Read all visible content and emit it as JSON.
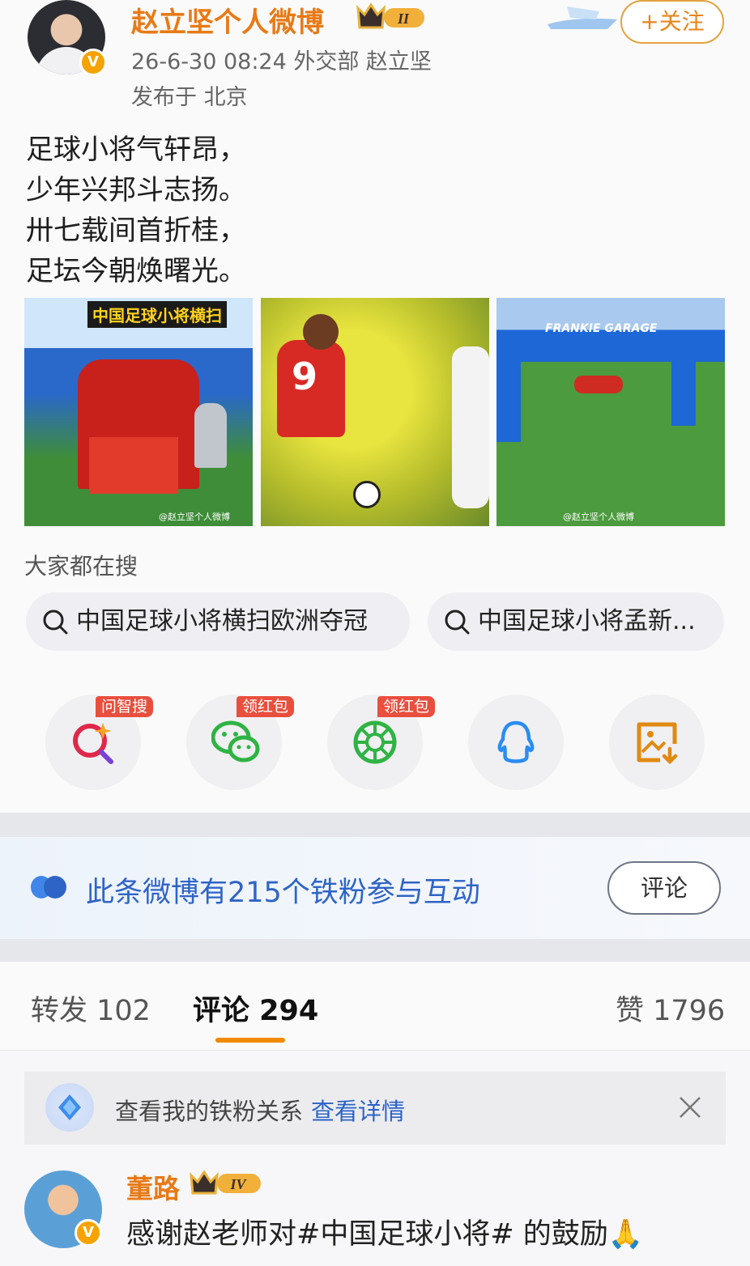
{
  "post": {
    "username": "赵立坚个人微博",
    "level_badge": "II",
    "meta_line": "26-6-30 08:24  外交部 赵立坚",
    "location": "发布于 北京",
    "follow_label": "+关注",
    "poem": [
      "足球小将气轩昂，",
      "少年兴邦斗志扬。",
      "卅七载间首折桂，",
      "足坛今朝焕曙光。"
    ],
    "images": [
      {
        "banner": "中国足球小将横扫",
        "watermark": "@赵立坚个人微博"
      },
      {
        "jersey": "9",
        "watermark": ""
      },
      {
        "banner": "FRANKIE GARAGE",
        "watermark": "@赵立坚个人微博"
      }
    ]
  },
  "hot_search": {
    "title": "大家都在搜",
    "items": [
      "中国足球小将横扫欧洲夺冠",
      "中国足球小将孟新..."
    ]
  },
  "share": {
    "items": [
      {
        "icon": "search-ai-icon",
        "tag": "问智搜"
      },
      {
        "icon": "wechat-icon",
        "tag": "领红包"
      },
      {
        "icon": "moments-icon",
        "tag": "领红包"
      },
      {
        "icon": "qq-icon",
        "tag": ""
      },
      {
        "icon": "save-image-icon",
        "tag": ""
      }
    ]
  },
  "iron_fans": {
    "text": "此条微博有215个铁粉参与互动",
    "button": "评论"
  },
  "tabs": {
    "repost": "转发 102",
    "comment": "评论 294",
    "like": "赞 1796"
  },
  "notice": {
    "text": "查看我的铁粉关系",
    "link": "查看详情"
  },
  "comment": {
    "username": "董路",
    "level_badge": "IV",
    "text": "感谢赵老师对#中国足球小将# 的鼓励🙏"
  },
  "colors": {
    "accent": "#e87a16",
    "link": "#2b63c7",
    "tag_red": "#e94f3d"
  }
}
